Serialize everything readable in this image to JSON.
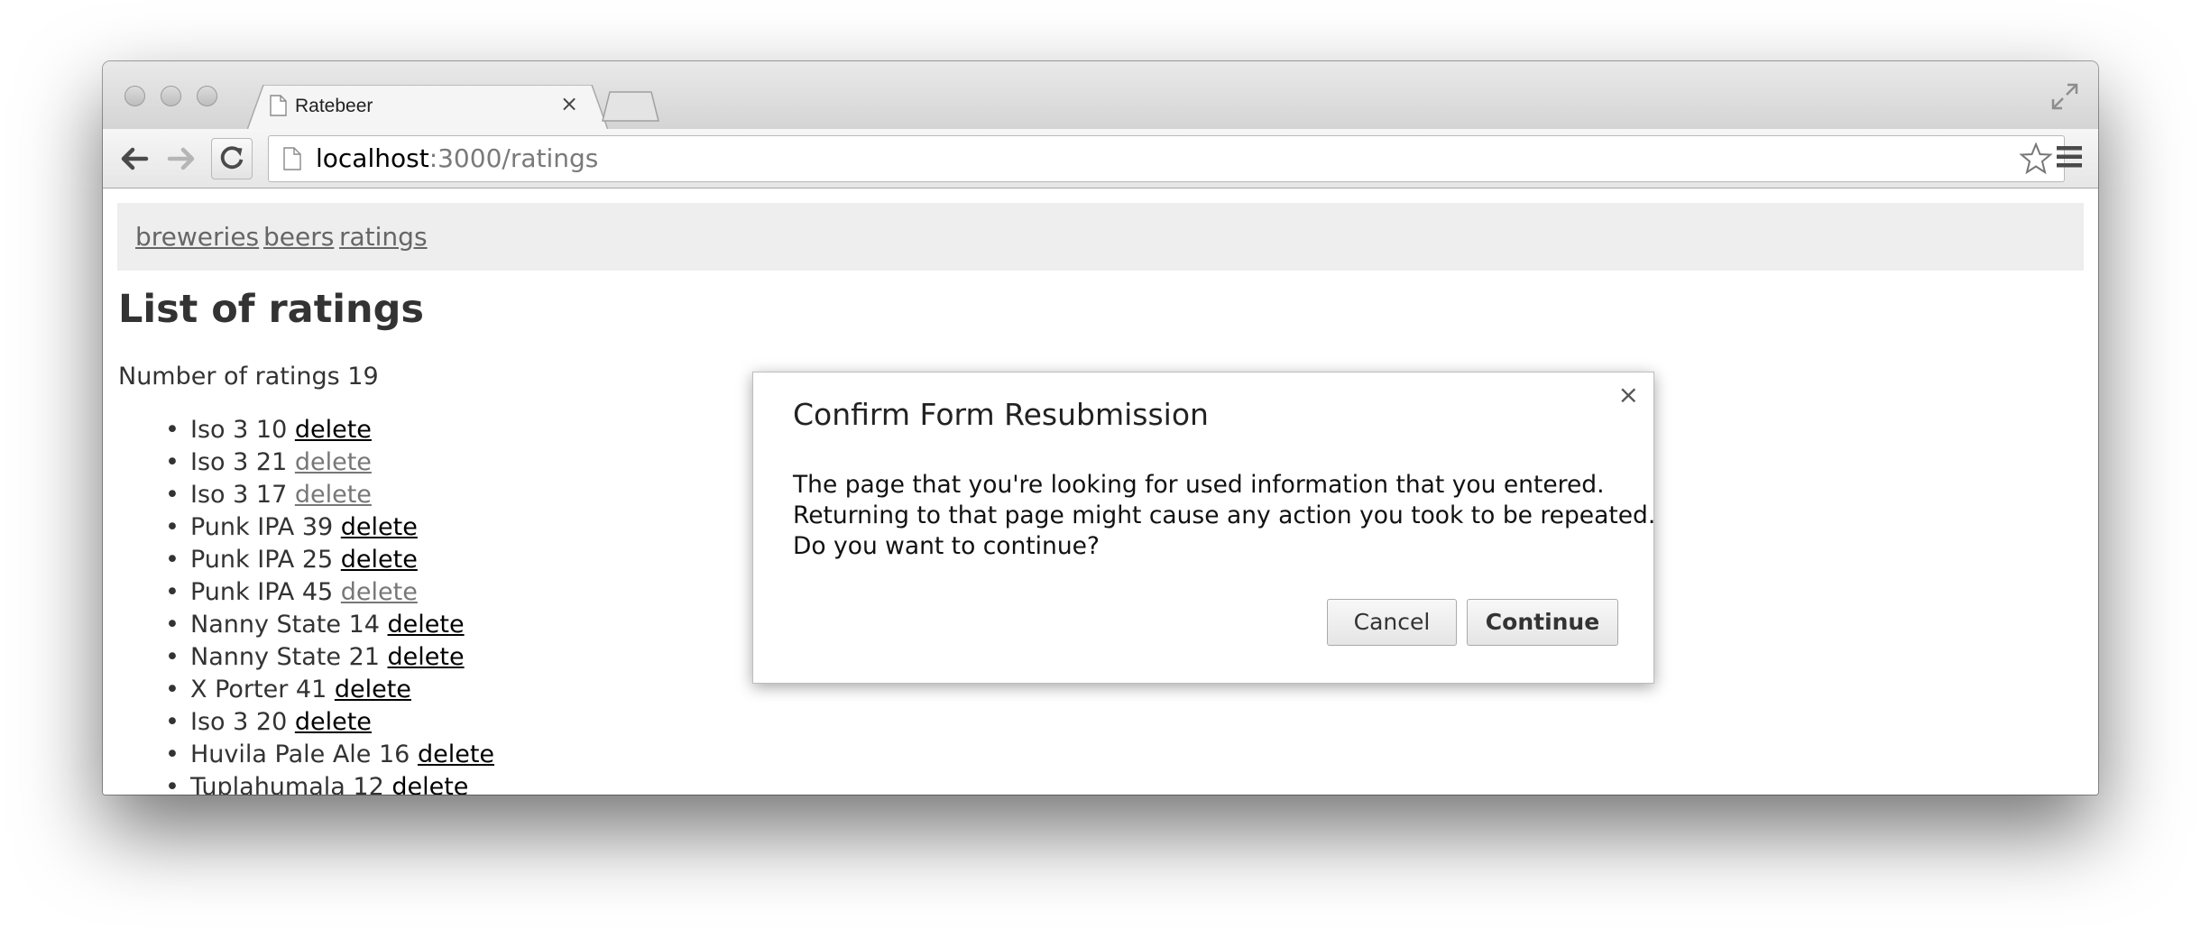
{
  "browser": {
    "tab_title": "Ratebeer",
    "url_host": "localhost",
    "url_rest": ":3000/ratings"
  },
  "nav": {
    "links": [
      "breweries",
      "beers",
      "ratings"
    ]
  },
  "page": {
    "title": "List of ratings",
    "count_label": "Number of ratings",
    "count_value": "19"
  },
  "ratings": [
    {
      "text": "Iso 3 10",
      "link": "delete",
      "visited": false
    },
    {
      "text": "Iso 3 21",
      "link": "delete",
      "visited": true
    },
    {
      "text": "Iso 3 17",
      "link": "delete",
      "visited": true
    },
    {
      "text": "Punk IPA 39",
      "link": "delete",
      "visited": false
    },
    {
      "text": "Punk IPA 25",
      "link": "delete",
      "visited": false
    },
    {
      "text": "Punk IPA 45",
      "link": "delete",
      "visited": true
    },
    {
      "text": "Nanny State 14",
      "link": "delete",
      "visited": false
    },
    {
      "text": "Nanny State 21",
      "link": "delete",
      "visited": false
    },
    {
      "text": "X Porter 41",
      "link": "delete",
      "visited": false
    },
    {
      "text": "Iso 3 20",
      "link": "delete",
      "visited": false
    },
    {
      "text": "Huvila Pale Ale 16",
      "link": "delete",
      "visited": false
    },
    {
      "text": "Tuplahumala 12",
      "link": "delete",
      "visited": false
    }
  ],
  "dialog": {
    "title": "Confirm Form Resubmission",
    "close": "×",
    "lines": [
      "The page that you're looking for used information that you entered.",
      "Returning to that page might cause any action you took to be repeated.",
      "Do you want to continue?"
    ],
    "cancel_label": "Cancel",
    "continue_label": "Continue"
  },
  "icons": {
    "tab_close": "×"
  }
}
